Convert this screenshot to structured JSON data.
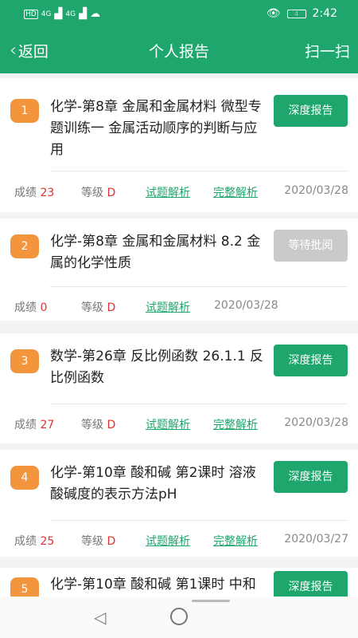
{
  "status": {
    "network_left": "HD",
    "signal1": "4G",
    "signal2": "4G",
    "battery": "4",
    "time": "2:42"
  },
  "nav": {
    "back": "返回",
    "title": "个人报告",
    "scan": "扫一扫"
  },
  "reports": [
    {
      "index": "1",
      "title": "化学-第8章 金属和金属材料 微型专题训练一 金属活动顺序的判断与应用",
      "action": "深度报告",
      "score_label": "成绩",
      "score": "23",
      "grade_label": "等级",
      "grade": "D",
      "analysis": "试题解析",
      "full": "完整解析",
      "date": "2020/03/28"
    },
    {
      "index": "2",
      "title": "化学-第8章 金属和金属材料 8.2 金属的化学性质",
      "action": "等待批阅",
      "score_label": "成绩",
      "score": "0",
      "grade_label": "等级",
      "grade": "D",
      "analysis": "试题解析",
      "date": "2020/03/28"
    },
    {
      "index": "3",
      "title": "数学-第26章 反比例函数 26.1.1 反比例函数",
      "action": "深度报告",
      "score_label": "成绩",
      "score": "27",
      "grade_label": "等级",
      "grade": "D",
      "analysis": "试题解析",
      "full": "完整解析",
      "date": "2020/03/28"
    },
    {
      "index": "4",
      "title": "化学-第10章 酸和碱 第2课时 溶液酸碱度的表示方法pH",
      "action": "深度报告",
      "score_label": "成绩",
      "score": "25",
      "grade_label": "等级",
      "grade": "D",
      "analysis": "试题解析",
      "full": "完整解析",
      "date": "2020/03/27"
    },
    {
      "index": "5",
      "title": "化学-第10章 酸和碱 第1课时 中和",
      "action": "深度报告"
    }
  ],
  "colors": {
    "primary": "#1fa66d",
    "badge": "#f3953c",
    "pending": "#cacaca",
    "grade": "#e0302f"
  }
}
